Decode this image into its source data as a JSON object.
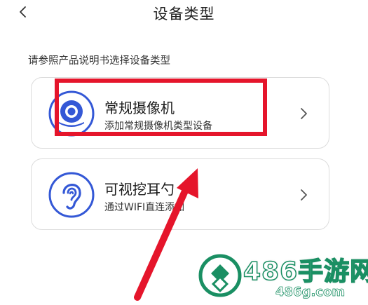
{
  "header": {
    "title": "设备类型",
    "back_icon": "chevron-left-icon"
  },
  "hint": "请参照产品说明书选择设备类型",
  "devices": [
    {
      "name": "常规摄像机",
      "desc": "添加常规摄像机类型设备",
      "icon": "camera-icon",
      "highlighted": true
    },
    {
      "name": "可视挖耳勺",
      "desc": "通过WIFI直连添加",
      "icon": "ear-icon",
      "highlighted": false
    }
  ],
  "colors": {
    "icon_blue": "#3458d6",
    "annotation_red": "#e5152b",
    "watermark_green": "#1a8f63"
  },
  "watermark": {
    "brand": "486手游网",
    "url": "486g.com",
    "icon": "watermark-logo-icon"
  }
}
